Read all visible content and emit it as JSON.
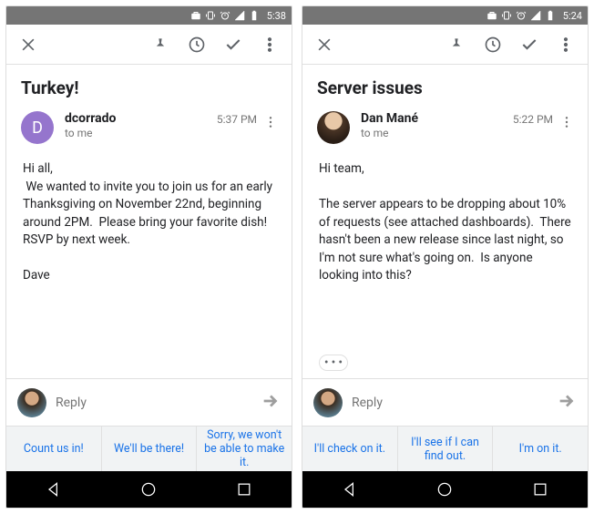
{
  "screens": [
    {
      "status_time": "5:38",
      "subject": "Turkey!",
      "avatar_letter": "D",
      "avatar_class": "av-purple",
      "avatar_type": "letter",
      "sender": "dcorrado",
      "to_line": "to me",
      "msg_time": "5:37 PM",
      "body": "Hi all,\n We wanted to invite you to join us for an early Thanksgiving on November 22nd, beginning around 2PM.  Please bring your favorite dish!  RSVP by next week.\n\nDave",
      "show_expand": false,
      "reply_placeholder": "Reply",
      "smart_replies": [
        "Count us in!",
        "We'll be there!",
        "Sorry, we won't be able to make it."
      ]
    },
    {
      "status_time": "5:24",
      "subject": "Server issues",
      "avatar_letter": "",
      "avatar_class": "av-photo",
      "avatar_type": "photo",
      "sender": "Dan Mané",
      "to_line": "to me",
      "msg_time": "5:22 PM",
      "body": "Hi team,\n\nThe server appears to be dropping about 10% of requests (see attached dashboards).  There hasn't been a new release since last night, so I'm not sure what's going on.  Is anyone looking into this?",
      "show_expand": true,
      "reply_placeholder": "Reply",
      "smart_replies": [
        "I'll check on it.",
        "I'll see if I can find out.",
        "I'm on it."
      ]
    }
  ]
}
